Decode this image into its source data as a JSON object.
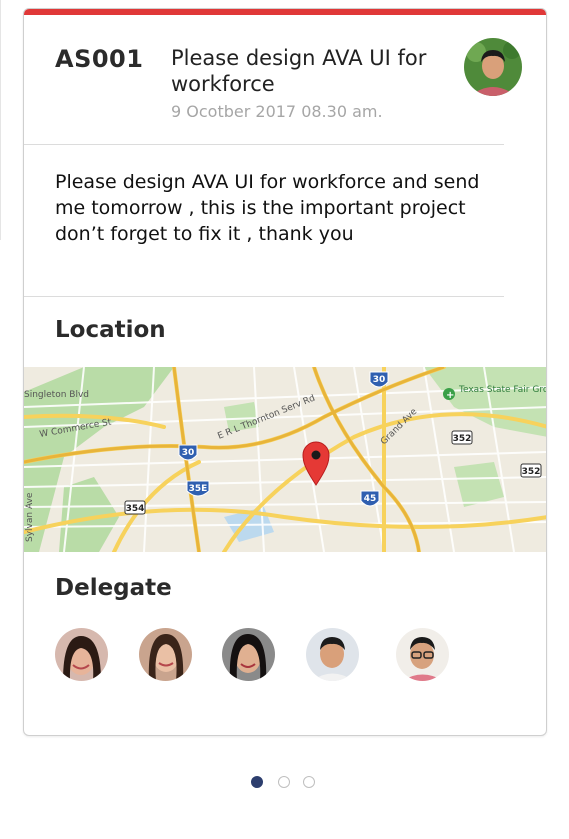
{
  "task": {
    "id": "AS001",
    "title": "Please design AVA UI for workforce",
    "date": "9 Ocotber 2017  08.30 am.",
    "description": "Please design AVA UI for workforce and send me tomorrow , this is the important project don’t forget to fix it , thank you"
  },
  "location": {
    "heading": "Location",
    "map_labels": {
      "place": "Texas State Fair Grounds",
      "street_singleton": "Singleton Blvd",
      "street_commerce": "W Commerce St",
      "street_thornton": "E R L Thornton Serv Rd",
      "street_grand": "Grand Ave",
      "street_sylvan": "Sylvan Ave",
      "shield_30_top": "30",
      "shield_30_mid": "30",
      "shield_35e": "35E",
      "shield_45": "45",
      "shield_352_a": "352",
      "shield_352_b": "352",
      "shield_354": "354"
    }
  },
  "delegate": {
    "heading": "Delegate",
    "count": 5
  },
  "pager": {
    "pages": 3,
    "active": 1
  },
  "colors": {
    "accent_bar": "#e03838",
    "pager_active": "#2d3e6e",
    "map_pin": "#e53935"
  }
}
